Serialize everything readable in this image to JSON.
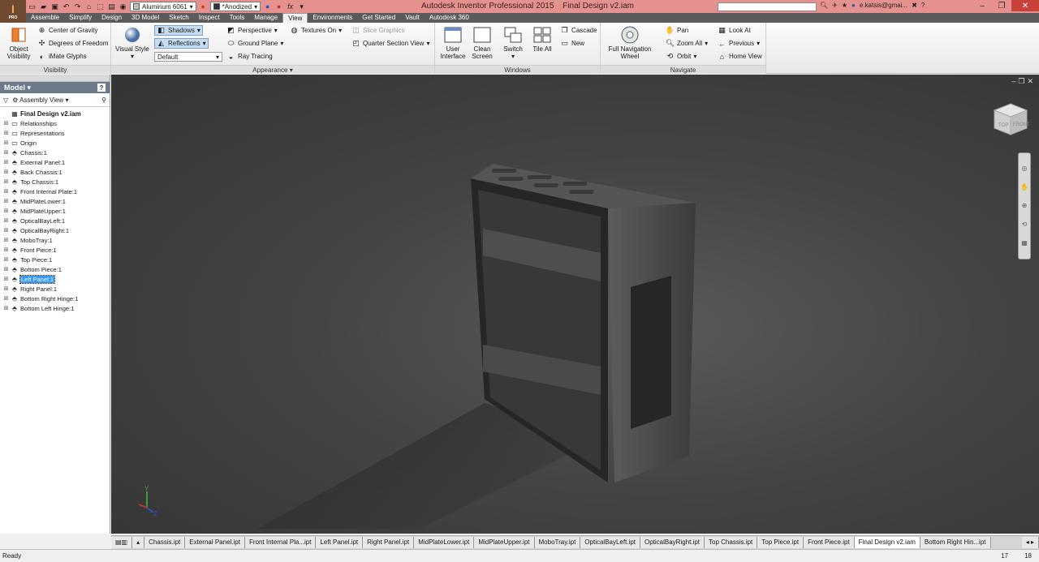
{
  "app": {
    "title": "Autodesk Inventor Professional 2015",
    "document": "Final Design v2.iam",
    "logo_letter": "I",
    "logo_sub": "PRO"
  },
  "quick_access": {
    "material": "Aluminum 6061",
    "appearance": "*Anodized"
  },
  "title_bar": {
    "user": "e.katsis@gmai..."
  },
  "menu_tabs": [
    "Assemble",
    "Simplify",
    "Design",
    "3D Model",
    "Sketch",
    "Inspect",
    "Tools",
    "Manage",
    "View",
    "Environments",
    "Get Started",
    "Vault",
    "Autodesk 360"
  ],
  "active_tab": "View",
  "ribbon": {
    "visibility": {
      "title": "Visibility",
      "object_visibility": "Object Visibility",
      "center_of_gravity": "Center of Gravity",
      "degrees_of_freedom": "Degrees of Freedom",
      "imate_glyphs": "iMate Glyphs"
    },
    "appearance": {
      "title": "Appearance",
      "visual_style": "Visual Style",
      "shadows": "Shadows",
      "reflections": "Reflections",
      "lighting": "Default",
      "perspective": "Perspective",
      "ground_plane": "Ground Plane",
      "ray_tracing": "Ray Tracing",
      "textures_on": "Textures On",
      "slice_graphics": "Slice Graphics",
      "quarter_section_view": "Quarter Section View"
    },
    "windows": {
      "title": "Windows",
      "user_interface": "User Interface",
      "clean_screen": "Clean Screen",
      "switch": "Switch",
      "tile_all": "Tile All",
      "cascade": "Cascade",
      "new": "New"
    },
    "navigate": {
      "title": "Navigate",
      "full_navigation_wheel": "Full Navigation Wheel",
      "pan": "Pan",
      "zoom_all": "Zoom All",
      "orbit": "Orbit",
      "look_at": "Look At",
      "previous": "Previous",
      "home_view": "Home View"
    }
  },
  "browser": {
    "title": "Model",
    "view": "Assembly View",
    "root": "Final Design v2.iam",
    "folders": [
      "Relationships",
      "Representations",
      "Origin"
    ],
    "parts": [
      "Chassis:1",
      "External Panel:1",
      "Back Chassis:1",
      "Top Chassis:1",
      "Front Internal Plate:1",
      "MidPlateLower:1",
      "MidPlateUpper:1",
      "OpticalBayLeft:1",
      "OpticalBayRight:1",
      "MoboTray:1",
      "Front Piece:1",
      "Top Piece:1",
      "Bottom Piece:1",
      "Left Panel:1",
      "Right Panel:1",
      "Bottom Right Hinge:1",
      "Bottom Left Hinge:1"
    ],
    "selected_part": "Left Panel:1"
  },
  "viewcube": {
    "top": "TOP",
    "front": "FRONT"
  },
  "document_tabs": [
    "Chassis.ipt",
    "External Panel.ipt",
    "Front Internal Pla...ipt",
    "Left Panel.ipt",
    "Right Panel.ipt",
    "MidPlateLower.ipt",
    "MidPlateUpper.ipt",
    "MoboTray.ipt",
    "OpticalBayLeft.ipt",
    "OpticalBayRight.ipt",
    "Top Chassis.ipt",
    "Top Piece.ipt",
    "Front Piece.ipt",
    "Final Design v2.iam",
    "Bottom Right Hin...ipt"
  ],
  "active_document_tab": "Final Design v2.iam",
  "status": {
    "text": "Ready",
    "num1": "17",
    "num2": "18"
  }
}
